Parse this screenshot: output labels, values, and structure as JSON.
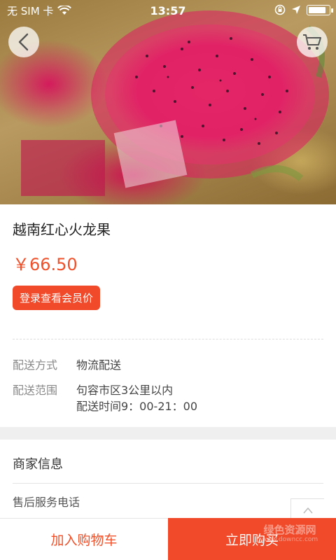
{
  "status_bar": {
    "carrier": "无 SIM 卡",
    "time": "13:57",
    "battery_level": 0.9
  },
  "hero": {
    "image": "dragon-fruit-photo",
    "back_icon": "chevron-left-icon",
    "cart_icon": "shopping-cart-icon"
  },
  "product": {
    "name": "越南红心火龙果",
    "price": "￥66.50",
    "member_button": "登录查看会员价"
  },
  "delivery": {
    "method_label": "配送方式",
    "method_value": "物流配送",
    "range_label": "配送范围",
    "range_value": "句容市区3公里以内",
    "time_value": "配送时间9：00-21：00"
  },
  "merchant": {
    "title": "商家信息",
    "after_sale_label": "售后服务电话"
  },
  "actions": {
    "add_to_cart": "加入购物车",
    "buy_now": "立即购买"
  },
  "watermark": {
    "text": "绿色资源网",
    "url": "www.downcc.com"
  },
  "colors": {
    "accent": "#f04a2a",
    "price": "#f0502a"
  }
}
